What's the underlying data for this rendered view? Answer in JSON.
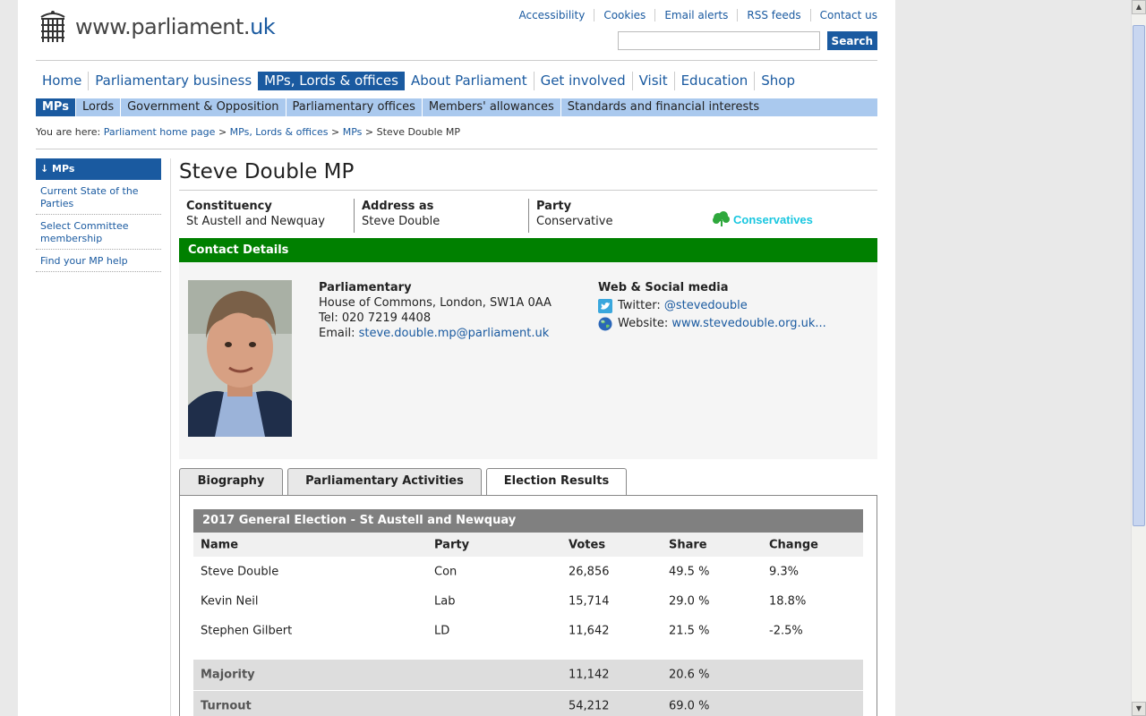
{
  "logo": {
    "text_main": "www.parliament.",
    "text_tld": "uk"
  },
  "utility_links": [
    "Accessibility",
    "Cookies",
    "Email alerts",
    "RSS feeds",
    "Contact us"
  ],
  "search": {
    "button": "Search",
    "value": ""
  },
  "main_nav": [
    {
      "label": "Home"
    },
    {
      "label": "Parliamentary business"
    },
    {
      "label": "MPs, Lords & offices",
      "active": true
    },
    {
      "label": "About Parliament"
    },
    {
      "label": "Get involved"
    },
    {
      "label": "Visit"
    },
    {
      "label": "Education"
    },
    {
      "label": "Shop"
    }
  ],
  "sub_nav": [
    {
      "label": "MPs",
      "active": true
    },
    {
      "label": "Lords"
    },
    {
      "label": "Government & Opposition"
    },
    {
      "label": "Parliamentary offices"
    },
    {
      "label": "Members' allowances"
    },
    {
      "label": "Standards and financial interests"
    }
  ],
  "breadcrumb": {
    "prefix": "You are here:",
    "links": [
      "Parliament home page",
      "MPs, Lords & offices",
      "MPs"
    ],
    "separator": ">",
    "current": "Steve Double MP"
  },
  "sidebar": {
    "heading": "↓ MPs",
    "items": [
      "Current State of the Parties",
      "Select Committee membership",
      "Find your MP help"
    ]
  },
  "mp": {
    "name": "Steve Double MP",
    "constituency_label": "Constituency",
    "constituency": "St Austell and Newquay",
    "address_label": "Address as",
    "address": "Steve Double",
    "party_label": "Party",
    "party": "Conservative",
    "party_logo_text": "Conservatives"
  },
  "contact": {
    "heading": "Contact Details",
    "parl_heading": "Parliamentary",
    "address": "House of Commons, London, SW1A 0AA",
    "tel": "Tel: 020 7219 4408",
    "email_label": "Email:",
    "email": "steve.double.mp@parliament.uk",
    "web_heading": "Web & Social media",
    "twitter_label": "Twitter:",
    "twitter": "@stevedouble",
    "website_label": "Website:",
    "website": "www.stevedouble.org.uk..."
  },
  "tabs": [
    {
      "label": "Biography"
    },
    {
      "label": "Parliamentary Activities"
    },
    {
      "label": "Election Results",
      "active": true
    }
  ],
  "election": {
    "title": "2017 General Election - St Austell and Newquay",
    "columns": [
      "Name",
      "Party",
      "Votes",
      "Share",
      "Change"
    ],
    "rows": [
      [
        "Steve Double",
        "Con",
        "26,856",
        "49.5 %",
        "9.3%"
      ],
      [
        "Kevin Neil",
        "Lab",
        "15,714",
        "29.0 %",
        "18.8%"
      ],
      [
        "Stephen Gilbert",
        "LD",
        "11,642",
        "21.5 %",
        "-2.5%"
      ]
    ],
    "majority": {
      "label": "Majority",
      "votes": "11,142",
      "share": "20.6 %"
    },
    "turnout": {
      "label": "Turnout",
      "votes": "54,212",
      "share": "69.0 %"
    }
  },
  "colors": {
    "brand_blue": "#1a5aa0",
    "subnav_bg": "#aac9ee",
    "contact_green": "#008000",
    "election_header": "#808080",
    "party_logo": "#1ac7e0"
  }
}
